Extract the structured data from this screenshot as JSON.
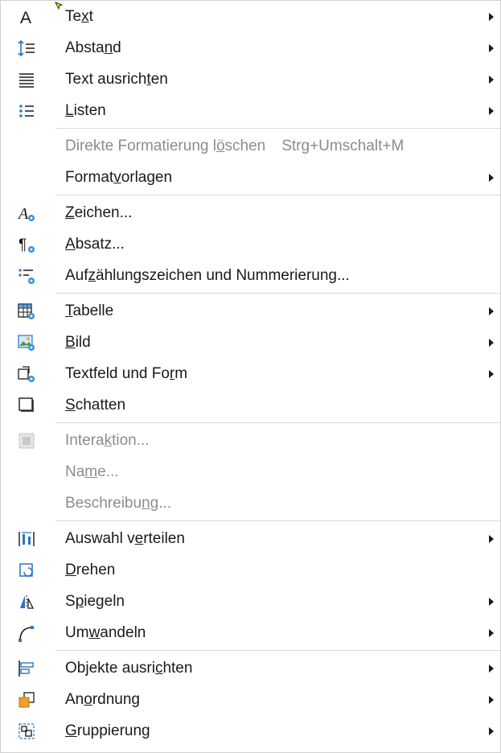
{
  "menu": {
    "items": [
      {
        "label": "Text",
        "underline": 2,
        "icon": "text-icon",
        "submenu": true,
        "disabled": false
      },
      {
        "label": "Abstand",
        "underline": 5,
        "icon": "spacing-icon",
        "submenu": true,
        "disabled": false
      },
      {
        "label": "Text ausrichten",
        "underline": 12,
        "icon": "align-text-icon",
        "submenu": true,
        "disabled": false
      },
      {
        "label": "Listen",
        "underline": 0,
        "icon": "list-icon",
        "submenu": true,
        "disabled": false
      },
      {
        "label": "Direkte Formatierung löschen",
        "underline": 22,
        "shortcut": "Strg+Umschalt+M",
        "icon": "",
        "submenu": false,
        "disabled": true
      },
      {
        "label": "Formatvorlagen",
        "underline": 6,
        "icon": "",
        "submenu": true,
        "disabled": false
      },
      {
        "label": "Zeichen...",
        "underline": 0,
        "icon": "character-icon",
        "submenu": false,
        "disabled": false
      },
      {
        "label": "Absatz...",
        "underline": 0,
        "icon": "paragraph-icon",
        "submenu": false,
        "disabled": false
      },
      {
        "label": "Aufzählungszeichen und Nummerierung...",
        "underline": 3,
        "icon": "bullets-numbering-icon",
        "submenu": false,
        "disabled": false
      },
      {
        "label": "Tabelle",
        "underline": 0,
        "icon": "table-icon",
        "submenu": true,
        "disabled": false
      },
      {
        "label": "Bild",
        "underline": 0,
        "icon": "image-icon",
        "submenu": true,
        "disabled": false
      },
      {
        "label": "Textfeld und Form",
        "underline": 15,
        "icon": "textbox-shape-icon",
        "submenu": true,
        "disabled": false
      },
      {
        "label": "Schatten",
        "underline": 0,
        "icon": "shadow-icon",
        "submenu": false,
        "disabled": false
      },
      {
        "label": "Interaktion...",
        "underline": 6,
        "icon": "interaction-icon",
        "submenu": false,
        "disabled": true
      },
      {
        "label": "Name...",
        "underline": 2,
        "icon": "",
        "submenu": false,
        "disabled": true
      },
      {
        "label": "Beschreibung...",
        "underline": 10,
        "icon": "",
        "submenu": false,
        "disabled": true
      },
      {
        "label": "Auswahl verteilen",
        "underline": 9,
        "icon": "distribute-icon",
        "submenu": true,
        "disabled": false
      },
      {
        "label": "Drehen",
        "underline": 0,
        "icon": "rotate-icon",
        "submenu": false,
        "disabled": false
      },
      {
        "label": "Spiegeln",
        "underline": 1,
        "icon": "flip-icon",
        "submenu": true,
        "disabled": false
      },
      {
        "label": "Umwandeln",
        "underline": 2,
        "icon": "convert-icon",
        "submenu": true,
        "disabled": false
      },
      {
        "label": "Objekte ausrichten",
        "underline": 13,
        "icon": "align-objects-icon",
        "submenu": true,
        "disabled": false
      },
      {
        "label": "Anordnung",
        "underline": 2,
        "icon": "arrange-icon",
        "submenu": true,
        "disabled": false
      },
      {
        "label": "Gruppierung",
        "underline": 0,
        "icon": "group-icon",
        "submenu": true,
        "disabled": false
      }
    ],
    "separators_after": [
      3,
      5,
      8,
      12,
      15,
      19
    ],
    "colors": {
      "text": "#1a1a1a",
      "disabled": "#8c8c8c",
      "icon_blue": "#2b73c9",
      "icon_gear": "#3a8fd9",
      "icon_orange": "#f0a030"
    }
  }
}
